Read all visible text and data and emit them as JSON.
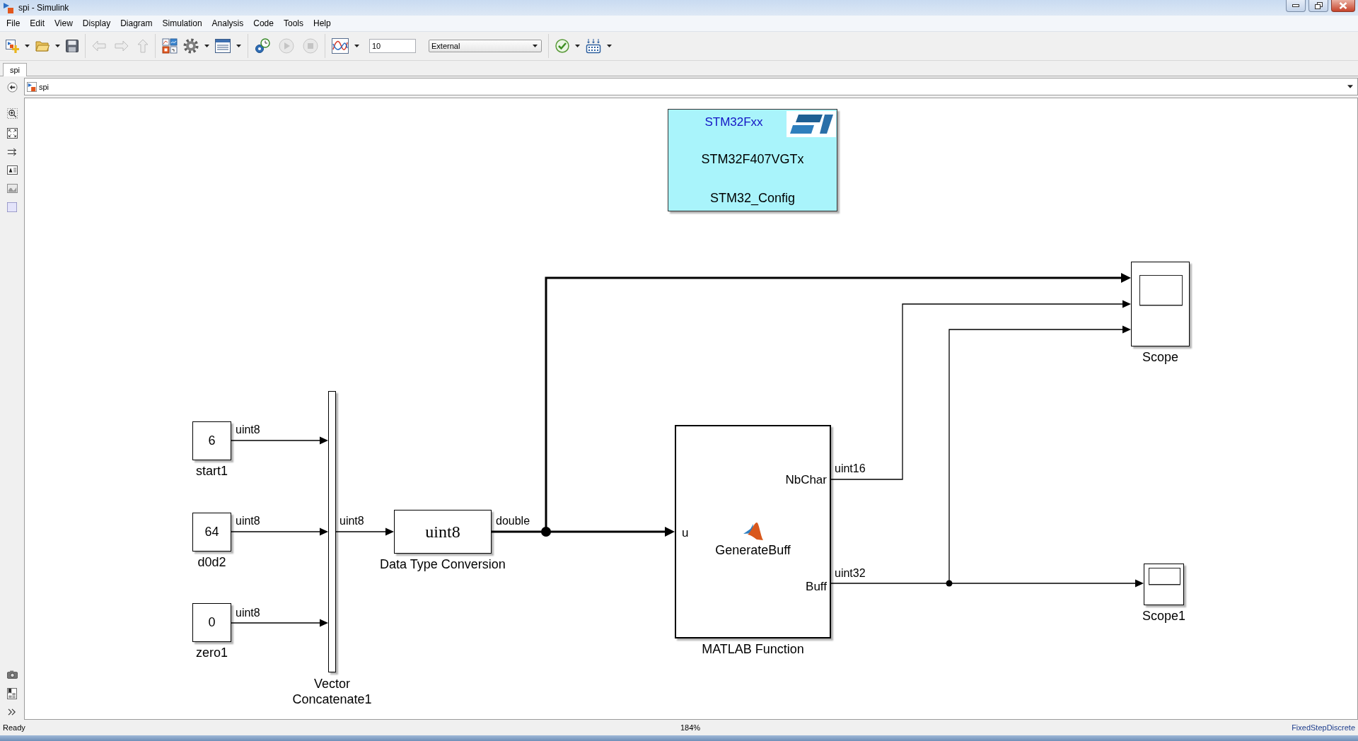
{
  "window": {
    "title": "spi - Simulink"
  },
  "menu": [
    "File",
    "Edit",
    "View",
    "Display",
    "Diagram",
    "Simulation",
    "Analysis",
    "Code",
    "Tools",
    "Help"
  ],
  "toolbar": {
    "back": {
      "disabled": true
    },
    "forward": {
      "disabled": true
    },
    "up": {
      "disabled": true
    },
    "run": {
      "disabled": true
    },
    "stop": {
      "disabled": true
    },
    "stop_time": "10",
    "simulation_mode": "External"
  },
  "tabs": [
    {
      "label": "spi",
      "selected": true
    }
  ],
  "address_bar": {
    "path": "spi"
  },
  "diagram": {
    "blocks": [
      {
        "kind": "board_config",
        "name": "STM32_Config",
        "family": "STM32Fxx",
        "device": "STM32F407VGTx"
      },
      {
        "kind": "constant",
        "name": "start1",
        "value": "6"
      },
      {
        "kind": "constant",
        "name": "d0d2",
        "value": "64"
      },
      {
        "kind": "constant",
        "name": "zero1",
        "value": "0"
      },
      {
        "kind": "concatenate",
        "name": "Vector Concatenate1"
      },
      {
        "kind": "conversion",
        "name": "Data Type Conversion",
        "display": "uint8"
      },
      {
        "kind": "function",
        "name": "MATLAB Function",
        "title": "GenerateBuff",
        "inputs": [
          "u"
        ],
        "outputs": [
          "NbChar",
          "Buff"
        ]
      },
      {
        "kind": "scope",
        "name": "Scope"
      },
      {
        "kind": "scope",
        "name": "Scope1"
      }
    ],
    "signals": [
      {
        "data_type": "uint8"
      },
      {
        "data_type": "uint8"
      },
      {
        "data_type": "uint8"
      },
      {
        "data_type": "uint8"
      },
      {
        "data_type": "double"
      },
      {
        "data_type": "uint16"
      },
      {
        "data_type": "uint32"
      }
    ]
  },
  "status_bar": {
    "message": "Ready",
    "zoom": "184%",
    "solver": "FixedStepDiscrete"
  }
}
